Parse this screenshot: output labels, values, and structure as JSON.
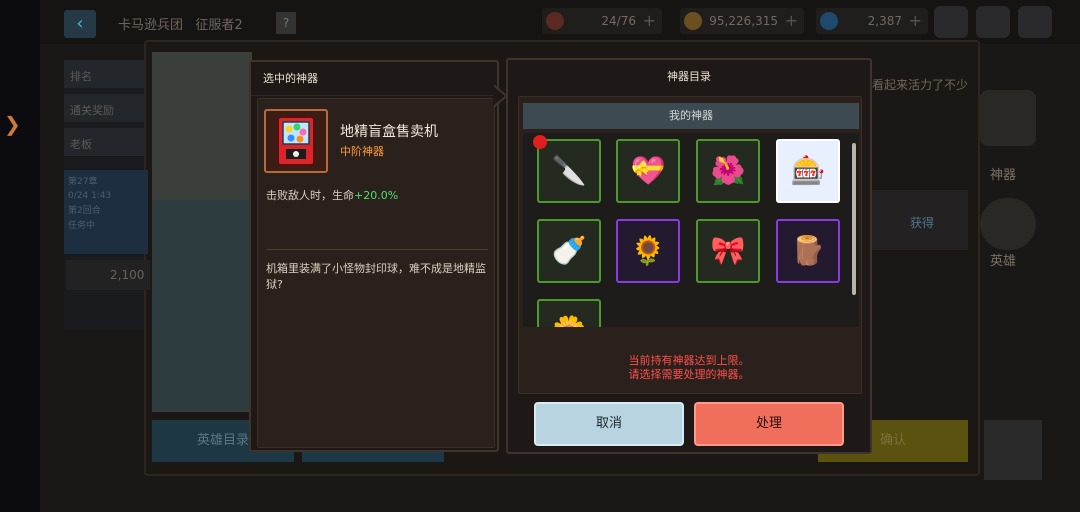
{
  "background": {
    "title": "卡马逊兵团",
    "subtitle": "征服者2",
    "help": "?",
    "resources": [
      {
        "name": "stamina",
        "value": "24/76",
        "color": "#c23a2a"
      },
      {
        "name": "gold",
        "value": "95,226,315",
        "color": "#c98c1c"
      },
      {
        "name": "gems",
        "value": "2,387",
        "color": "#2e8be0"
      }
    ],
    "left_list": [
      "排名",
      "通关奖励",
      "老板"
    ],
    "left_info": [
      "第27章",
      "0/24 1:43",
      "第2回合",
      "任务中"
    ],
    "power_value": "2,100",
    "right_hint": "看起来活力了不少",
    "obtain_label": "获得",
    "side_labels": [
      "神器",
      "英雄"
    ],
    "hero_list_button": "英雄目录",
    "confirm_button": "确认"
  },
  "detail": {
    "header": "选中的神器",
    "item_name": "地精盲盒售卖机",
    "rarity": "中阶神器",
    "effect_prefix": "击败敌人时，生命",
    "effect_value": "+20.0%",
    "description": "机箱里装满了小怪物封印球，难不成是地精监狱?"
  },
  "catalog": {
    "header": "神器目录",
    "tab_label": "我的神器",
    "items": [
      {
        "name": "cleaver",
        "rarity": "green",
        "selected": false,
        "glyph": "🔪",
        "badge": true
      },
      {
        "name": "heart-pendant",
        "rarity": "green",
        "selected": false,
        "glyph": "💝",
        "badge": false
      },
      {
        "name": "rafflesia-flower",
        "rarity": "green",
        "selected": false,
        "glyph": "🌺",
        "badge": false
      },
      {
        "name": "gacha-machine",
        "rarity": "white",
        "selected": true,
        "glyph": "🎰",
        "badge": false
      },
      {
        "name": "milk-bottle",
        "rarity": "green",
        "selected": false,
        "glyph": "🍼",
        "badge": false
      },
      {
        "name": "carnivorous-plant",
        "rarity": "purple",
        "selected": false,
        "glyph": "🌻",
        "badge": false
      },
      {
        "name": "pink-jelly",
        "rarity": "green",
        "selected": false,
        "glyph": "🎀",
        "badge": false
      },
      {
        "name": "red-branch",
        "rarity": "purple",
        "selected": false,
        "glyph": "🪵",
        "badge": false
      },
      {
        "name": "golden-nugget",
        "rarity": "green",
        "selected": false,
        "glyph": "🌼",
        "badge": false
      }
    ],
    "limit_message_line1": "当前持有神器达到上限。",
    "limit_message_line2": "请选择需要处理的神器。",
    "cancel_label": "取消",
    "process_label": "处理"
  }
}
